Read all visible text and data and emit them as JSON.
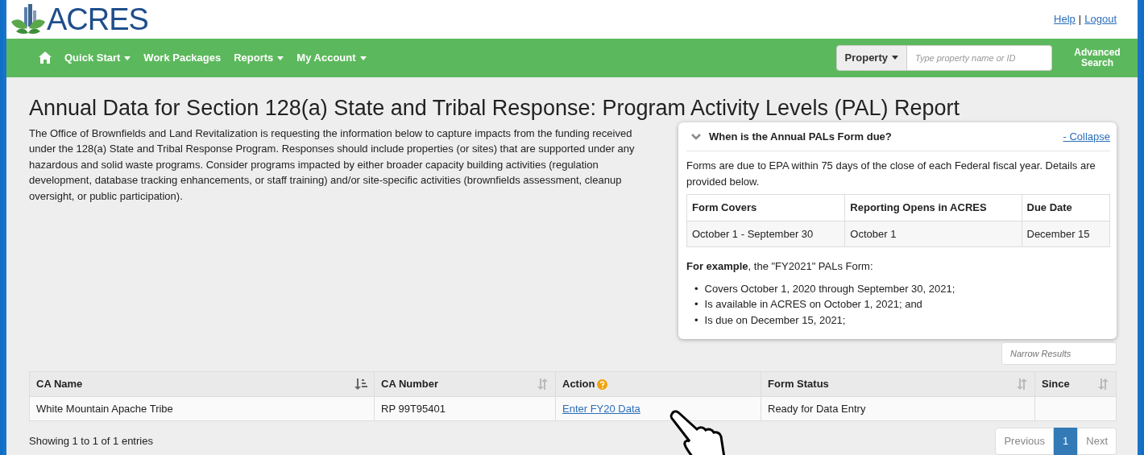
{
  "header": {
    "logo": "ACRES",
    "links": [
      "Help",
      "Logout"
    ],
    "separator": "|"
  },
  "nav": {
    "items": [
      {
        "label": "Quick Start",
        "dropdown": true
      },
      {
        "label": "Work Packages",
        "dropdown": false
      },
      {
        "label": "Reports",
        "dropdown": true
      },
      {
        "label": "My Account",
        "dropdown": true
      }
    ],
    "search_type": "Property",
    "search": {
      "placeholder": "Type property name or ID"
    },
    "advanced": "Advanced Search"
  },
  "title": "Annual Data for Section 128(a) State and Tribal Response: Program Activity Levels (PAL) Report",
  "intro": "The Office of Brownfields and Land Revitalization is requesting the information below to capture impacts from the funding received under the 128(a) State and Tribal Response Program. Responses should include properties (or sites) that are supported under any hazardous and solid waste programs. Consider programs impacted by either broader capacity building activities (regulation development, database tracking enhancements, or staff training) and/or site-specific activities (brownfields assessment, cleanup oversight, or public participation).",
  "panel": {
    "title": "When is the Annual PALs Form due?",
    "expanded": true,
    "toggle": "- Collapse",
    "text": "Forms are due to EPA within 75 days of the close of each Federal fiscal year. Details are provided below.",
    "columns": [
      "Form Covers",
      "Reporting Opens in ACRES",
      "Due Date"
    ],
    "rows": [
      [
        "October 1 - September 30",
        "October 1",
        "December 15"
      ]
    ],
    "example": "**For example**, the \"FY2021\" PALs Form:",
    "bullet": "•",
    "bullets": [
      "Covers October 1, 2020 through September 30, 2021;",
      "Is available in ACRES on October 1, 2021; and",
      "Is due on December 15, 2021;"
    ]
  },
  "filter": {
    "placeholder": "Narrow Results"
  },
  "table": {
    "columns": [
      {
        "label": "CA Name",
        "sortable": true,
        "sorted": true,
        "help": false
      },
      {
        "label": "CA Number",
        "sortable": true,
        "sorted": false,
        "help": false
      },
      {
        "label": "Action",
        "sortable": false,
        "help": true
      },
      {
        "label": "Form Status",
        "sortable": true,
        "sorted": false,
        "help": false
      },
      {
        "label": "Since",
        "sortable": true,
        "sorted": false,
        "help": false
      }
    ],
    "rows": [
      {
        "cells": [
          {
            "kind": "text",
            "text": "White Mountain Apache Tribe"
          },
          {
            "kind": "text",
            "text": "RP 99T95401"
          },
          {
            "kind": "link",
            "text": "Enter FY20 Data"
          },
          {
            "kind": "text",
            "text": "Ready for Data Entry"
          },
          {
            "kind": "empty"
          }
        ]
      }
    ]
  },
  "info": "Showing 1 to 1 of 1 entries",
  "pagination": [
    {
      "label": "Previous",
      "selected": false,
      "disabled": true
    },
    {
      "label": "1",
      "selected": true,
      "disabled": false
    },
    {
      "label": "Next",
      "selected": false,
      "disabled": true
    }
  ]
}
